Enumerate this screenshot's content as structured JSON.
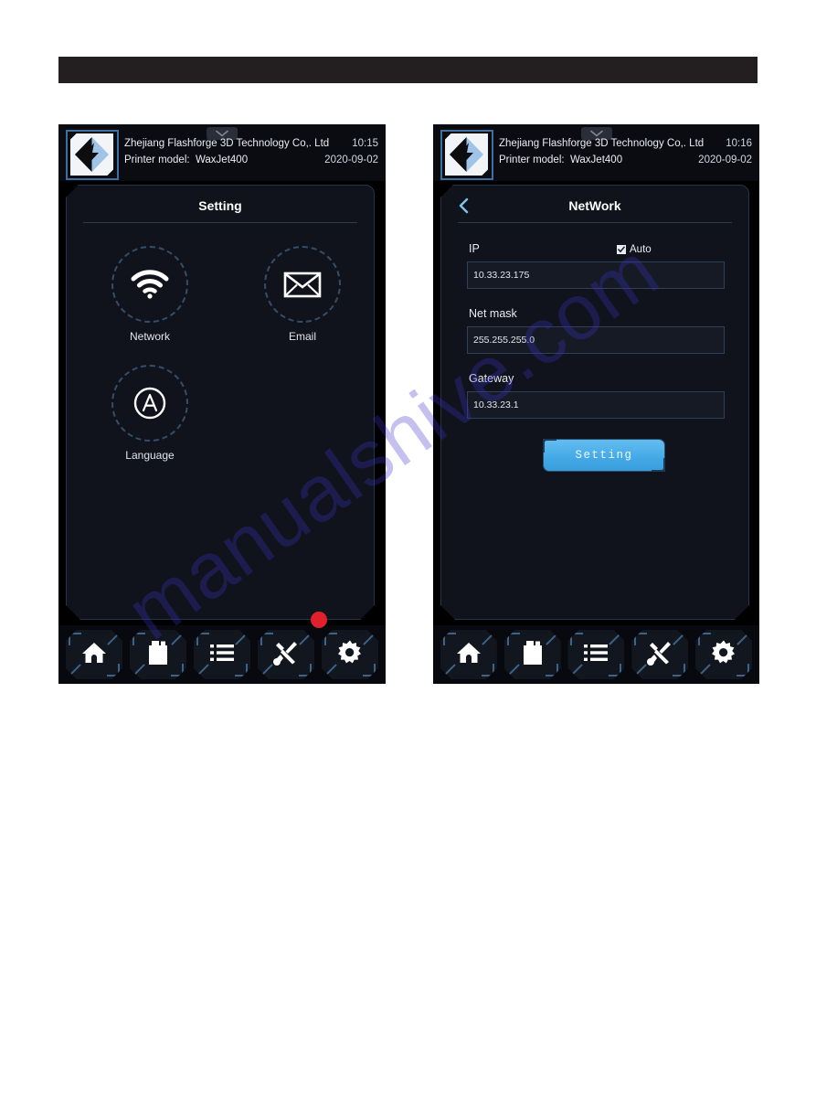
{
  "page": {
    "background_color": "#ffffff",
    "redacted_band_color": "#231f20",
    "watermark_text": "manualshive.com"
  },
  "screens": [
    {
      "id": "setting-screen",
      "status_bar": {
        "dropdown_icon": "chevron-down-icon",
        "logo_icon": "flashforge-logo-icon",
        "company": "Zhejiang Flashforge 3D Technology Co,. Ltd",
        "time": "10:15",
        "model_label": "Printer model:",
        "model_value": "WaxJet400",
        "date": "2020-09-02"
      },
      "panel": {
        "title": "Setting",
        "tiles": [
          {
            "icon": "wifi-icon",
            "label": "Network"
          },
          {
            "icon": "envelope-icon",
            "label": "Email"
          },
          {
            "icon": "letter-a-circle-icon",
            "label": "Language"
          }
        ]
      },
      "nav": {
        "items": [
          {
            "icon": "home-icon",
            "name": "nav-home"
          },
          {
            "icon": "ink-cartridge-icon",
            "name": "nav-material"
          },
          {
            "icon": "list-icon",
            "name": "nav-list"
          },
          {
            "icon": "tools-icon",
            "name": "nav-tools"
          },
          {
            "icon": "gear-icon",
            "name": "nav-settings"
          }
        ],
        "active_index": 4,
        "badge": {
          "visible": true,
          "color": "#e0202b",
          "on_index": 4
        }
      }
    },
    {
      "id": "network-screen",
      "status_bar": {
        "dropdown_icon": "chevron-down-icon",
        "logo_icon": "flashforge-logo-icon",
        "company": "Zhejiang Flashforge 3D Technology Co,. Ltd",
        "time": "10:16",
        "model_label": "Printer model:",
        "model_value": "WaxJet400",
        "date": "2020-09-02"
      },
      "panel": {
        "title": "NetWork",
        "back_icon": "chevron-left-icon",
        "auto": {
          "label": "Auto",
          "checked": true
        },
        "fields": [
          {
            "label": "IP",
            "value": "10.33.23.175"
          },
          {
            "label": "Net mask",
            "value": "255.255.255.0"
          },
          {
            "label": "Gateway",
            "value": "10.33.23.1"
          }
        ],
        "submit_label": "Setting"
      },
      "nav": {
        "items": [
          {
            "icon": "home-icon",
            "name": "nav-home"
          },
          {
            "icon": "ink-cartridge-icon",
            "name": "nav-material"
          },
          {
            "icon": "list-icon",
            "name": "nav-list"
          },
          {
            "icon": "tools-icon",
            "name": "nav-tools"
          },
          {
            "icon": "gear-icon",
            "name": "nav-settings"
          }
        ],
        "active_index": 4,
        "badge": {
          "visible": false
        }
      }
    }
  ],
  "colors": {
    "screen_bg": "#000000",
    "panel_bg": "#10131b",
    "panel_border": "#263349",
    "accent_blue": "#43a9e6",
    "text_primary": "#e9eef5",
    "ring_color": "#3b5878"
  }
}
